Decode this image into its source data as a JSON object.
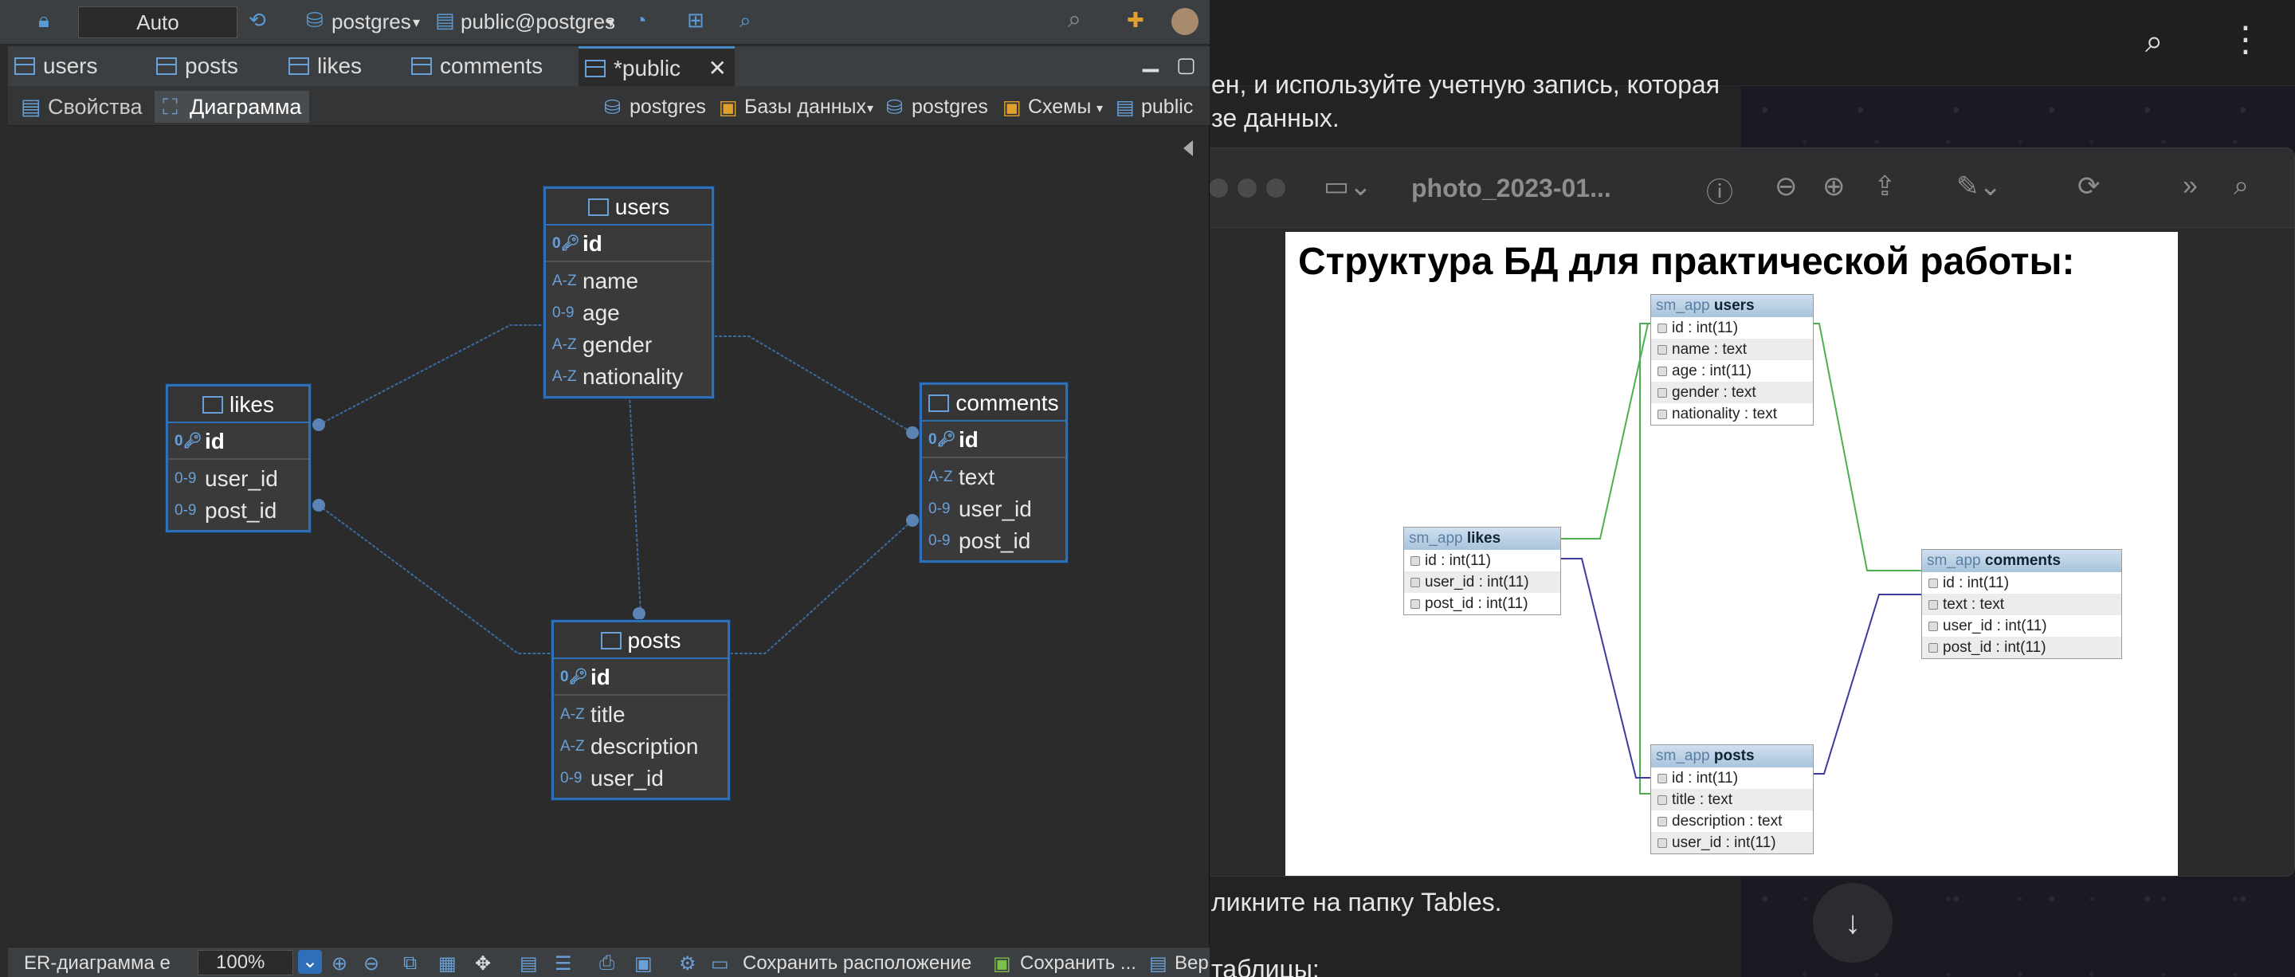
{
  "background_app": {
    "lines": [
      "ен, и используйте учетную запись, которая",
      "зе данных.",
      "ликните на папку Tables.",
      "таблицы:"
    ],
    "search_icon": "search-icon",
    "menu_icon": "more-vert-icon",
    "scroll_down_icon": "arrow-down-icon"
  },
  "preview": {
    "title": "photo_2023-01...",
    "doc_title": "Структура БД для практической работы:",
    "schema_prefix": "sm_app",
    "tables": {
      "users": {
        "name": "users",
        "rows": [
          "id : int(11)",
          "name : text",
          "age : int(11)",
          "gender : text",
          "nationality : text"
        ]
      },
      "likes": {
        "name": "likes",
        "rows": [
          "id : int(11)",
          "user_id : int(11)",
          "post_id : int(11)"
        ]
      },
      "comments": {
        "name": "comments",
        "rows": [
          "id : int(11)",
          "text : text",
          "user_id : int(11)",
          "post_id : int(11)"
        ]
      },
      "posts": {
        "name": "posts",
        "rows": [
          "id : int(11)",
          "title : text",
          "description : text",
          "user_id : int(11)"
        ]
      }
    }
  },
  "toolbar": {
    "mode": "Auto",
    "connection": "postgres",
    "schema": "public@postgres"
  },
  "tabs": [
    {
      "label": "users"
    },
    {
      "label": "posts"
    },
    {
      "label": "likes"
    },
    {
      "label": "comments"
    },
    {
      "label": "*public"
    }
  ],
  "subtabs": {
    "properties": "Свойства",
    "diagram": "Диаграмма"
  },
  "breadcrumbs": [
    "postgres",
    "Базы данных",
    "postgres",
    "Схемы",
    "public"
  ],
  "diagram": {
    "users": {
      "title": "users",
      "pk": "id",
      "columns": [
        {
          "type": "A-Z",
          "name": "name"
        },
        {
          "type": "0-9",
          "name": "age"
        },
        {
          "type": "A-Z",
          "name": "gender"
        },
        {
          "type": "A-Z",
          "name": "nationality"
        }
      ]
    },
    "likes": {
      "title": "likes",
      "pk": "id",
      "columns": [
        {
          "type": "0-9",
          "name": "user_id"
        },
        {
          "type": "0-9",
          "name": "post_id"
        }
      ]
    },
    "comments": {
      "title": "comments",
      "pk": "id",
      "columns": [
        {
          "type": "A-Z",
          "name": "text"
        },
        {
          "type": "0-9",
          "name": "user_id"
        },
        {
          "type": "0-9",
          "name": "post_id"
        }
      ]
    },
    "posts": {
      "title": "posts",
      "pk": "id",
      "columns": [
        {
          "type": "A-Z",
          "name": "title"
        },
        {
          "type": "A-Z",
          "name": "description"
        },
        {
          "type": "0-9",
          "name": "user_id"
        }
      ]
    }
  },
  "statusbar": {
    "label": "ER-диаграмма е",
    "zoom": "100%",
    "save_layout": "Сохранить расположение",
    "save": "Сохранить ...",
    "ver": "Вер"
  }
}
